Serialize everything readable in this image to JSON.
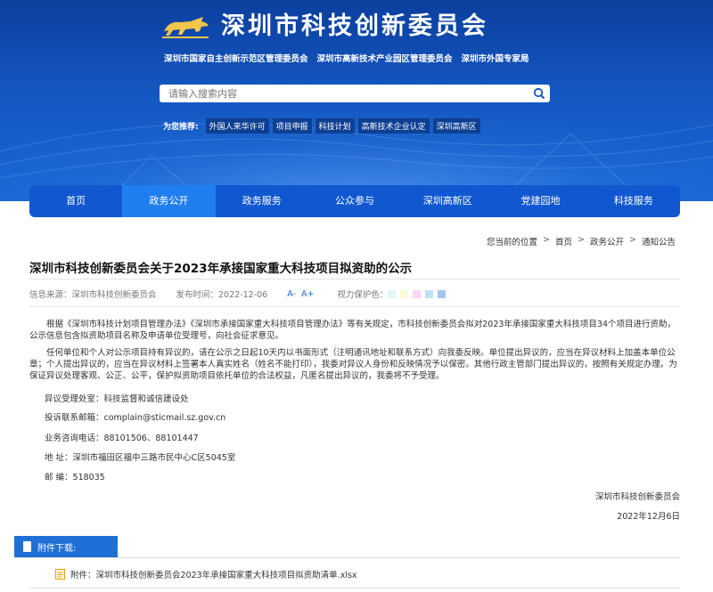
{
  "header": {
    "site_title": "深圳市科技创新委员会",
    "subtitles": [
      "深圳市国家自主创新示范区管理委员会",
      "深圳市高新技术产业园区管理委员会",
      "深圳市外国专家局"
    ],
    "search_placeholder": "请输入搜索内容",
    "recommend_label": "为您推荐:",
    "recommend_tags": [
      "外国人来华许可",
      "项目申报",
      "科技计划",
      "高新技术企业认定",
      "深圳高新区"
    ]
  },
  "nav": {
    "items": [
      "首页",
      "政务公开",
      "政务服务",
      "公众参与",
      "深圳高新区",
      "党建园地",
      "科技服务"
    ],
    "active_index": 1
  },
  "breadcrumb": {
    "prefix": "您当前的位置",
    "items": [
      "首页",
      "政务公开",
      "通知公告"
    ]
  },
  "article": {
    "title": "深圳市科技创新委员会关于2023年承接国家重大科技项目拟资助的公示",
    "source": "信息来源：深圳市科技创新委员会",
    "date": "发布时间：2022-12-06",
    "font_minus": "A-",
    "font_plus": "A+",
    "eye_label": "视力保护色：",
    "eye_colors": [
      "#dff6f8",
      "#fbfbd6",
      "#f7d6f4",
      "#bfe0f7",
      "#9fc7f0"
    ],
    "para1": "根据《深圳市科技计划项目管理办法》《深圳市承接国家重大科技项目管理办法》等有关规定，市科技创新委员会拟对2023年承接国家重大科技项目34个项目进行资助，公示信息包含拟资助项目名称及申请单位受理号，向社会征求意见。",
    "para2": "任何单位和个人对公示项目持有异议的，请在公示之日起10天内以书面形式（注明通讯地址和联系方式）向我委反映。单位提出异议的，应当在异议材料上加盖本单位公章；个人提出异议的，应当在异议材料上签署本人真实姓名（姓名不能打印），我委对异议人身份和反映情况予以保密。其他行政主管部门提出异议的，按照有关规定办理。为保证异议处理客观、公正、公平，保护拟资助项目依托单位的合法权益，凡匿名提出异议的，我委将不予受理。",
    "office": "异议受理处室：科技监督和诚信建设处",
    "email": "投诉联系邮箱：complain@sticmail.sz.gov.cn",
    "phone": "业务咨询电话：88101506、88101447",
    "address": "地  址：深圳市福田区福中三路市民中心C区5045室",
    "postcode": "邮  编：518035",
    "signer": "深圳市科技创新委员会",
    "sign_date": "2022年12月6日"
  },
  "attachments": {
    "header": "附件下载:",
    "items": [
      "附件：深圳市科技创新委员会2023年承接国家重大科技项目拟资助清单.xlsx"
    ]
  },
  "colors": {
    "banner": "#1456c0",
    "nav": "#1158d0",
    "nav_active": "#1f7ff0",
    "attach_header": "#1f6fd6"
  }
}
